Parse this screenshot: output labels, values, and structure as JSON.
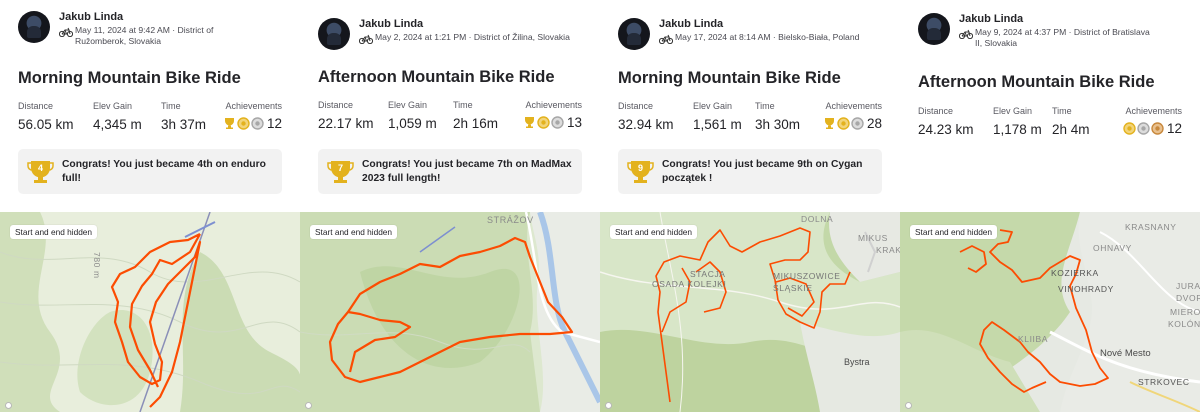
{
  "map_tag": "Start and end hidden",
  "colors": {
    "route": "#fc4c02",
    "gold": "#e3b21e",
    "silver": "#a7a7a7",
    "bronze": "#c8883c",
    "card_bg": "#f2f2f2"
  },
  "activities": [
    {
      "athlete": "Jakub Linda",
      "meta": "May 11, 2024 at 9:42 AM · District of Ružomberok, Slovakia",
      "sport_icon": "mountain-bike-icon",
      "title": "Morning Mountain Bike Ride",
      "stats": [
        {
          "label": "Distance",
          "value": "56.05 km"
        },
        {
          "label": "Elev Gain",
          "value": "4,345 m"
        },
        {
          "label": "Time",
          "value": "3h 37m"
        }
      ],
      "achievements": {
        "label": "Achievements",
        "medals": [
          "gold",
          "gold",
          "silver"
        ],
        "count": "12"
      },
      "congrats": {
        "rank": "4",
        "text": "Congrats! You just became 4th on enduro full!"
      },
      "map": {
        "places": [
          {
            "text": "780 m"
          }
        ]
      }
    },
    {
      "athlete": "Jakub Linda",
      "meta": "May 2, 2024 at 1:21 PM · District of Žilina, Slovakia",
      "sport_icon": "mountain-bike-icon",
      "title": "Afternoon Mountain Bike Ride",
      "stats": [
        {
          "label": "Distance",
          "value": "22.17 km"
        },
        {
          "label": "Elev Gain",
          "value": "1,059 m"
        },
        {
          "label": "Time",
          "value": "2h 16m"
        }
      ],
      "achievements": {
        "label": "Achievements",
        "medals": [
          "gold",
          "gold",
          "silver"
        ],
        "count": "13"
      },
      "congrats": {
        "rank": "7",
        "text": "Congrats! You just became 7th on MadMax 2023 full length!"
      },
      "map": {
        "places": [
          {
            "text": "STRÁŽOV"
          }
        ]
      }
    },
    {
      "athlete": "Jakub Linda",
      "meta": "May 17, 2024 at 8:14 AM · Bielsko-Biała, Poland",
      "sport_icon": "mountain-bike-icon",
      "title": "Morning Mountain Bike Ride",
      "stats": [
        {
          "label": "Distance",
          "value": "32.94 km"
        },
        {
          "label": "Elev Gain",
          "value": "1,561 m"
        },
        {
          "label": "Time",
          "value": "3h 30m"
        }
      ],
      "achievements": {
        "label": "Achievements",
        "medals": [
          "gold",
          "gold",
          "silver"
        ],
        "count": "28"
      },
      "congrats": {
        "rank": "9",
        "text": "Congrats! You just became 9th on Cygan początek !"
      },
      "map": {
        "places": [
          {
            "text": "DOLNA"
          },
          {
            "text": "MIKUS"
          },
          {
            "text": "KRAK"
          },
          {
            "text": "OSADA KOLEJKI"
          },
          {
            "text": "STACJA"
          },
          {
            "text": "MIKUSZOWICE ŚLĄSKIE"
          },
          {
            "text": "Bystra"
          }
        ]
      }
    },
    {
      "athlete": "Jakub Linda",
      "meta": "May 9, 2024 at 4:37 PM · District of Bratislava II, Slovakia",
      "sport_icon": "mountain-bike-icon",
      "title": "Afternoon Mountain Bike Ride",
      "stats": [
        {
          "label": "Distance",
          "value": "24.23 km"
        },
        {
          "label": "Elev Gain",
          "value": "1,178 m"
        },
        {
          "label": "Time",
          "value": "2h 4m"
        }
      ],
      "achievements": {
        "label": "Achievements",
        "medals": [
          "gold",
          "silver",
          "bronze"
        ],
        "count": "12"
      },
      "congrats": null,
      "map": {
        "places": [
          {
            "text": "KRASNANY"
          },
          {
            "text": "OHNAVY"
          },
          {
            "text": "KOZIERKA"
          },
          {
            "text": "VINOHRADY"
          },
          {
            "text": "JURA"
          },
          {
            "text": "DVOR"
          },
          {
            "text": "MIERO"
          },
          {
            "text": "KOLÓN"
          },
          {
            "text": "KLIIBA"
          },
          {
            "text": "Nové Mesto"
          },
          {
            "text": "STRKOVEC"
          }
        ]
      }
    }
  ]
}
